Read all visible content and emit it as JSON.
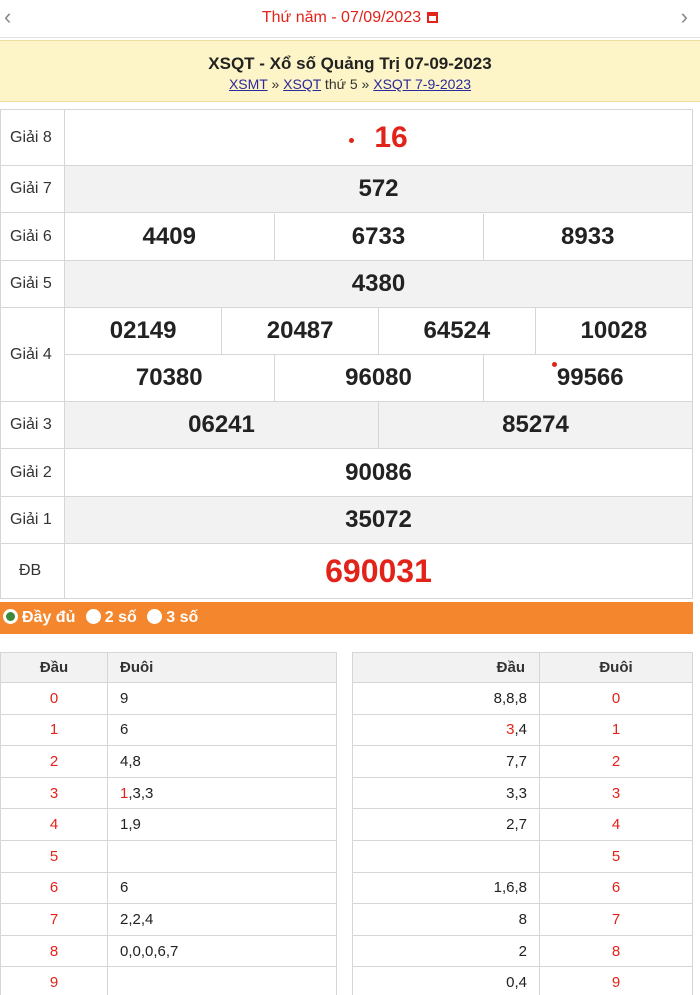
{
  "datebar": {
    "prev_icon": "chevron-left-icon",
    "next_icon": "chevron-right-icon",
    "date_label": "Thứ năm -  07/09/2023",
    "calendar_icon": "calendar-icon"
  },
  "title": {
    "heading": "XSQT - Xổ số Quảng Trị 07-09-2023",
    "crumb1": "XSMT",
    "sep1": " » ",
    "crumb2": "XSQT",
    "crumb2_suffix": " thứ 5",
    "sep2": " » ",
    "crumb3": "XSQT 7-9-2023"
  },
  "prizes": [
    {
      "label": "Giải 8",
      "values": [
        "16"
      ]
    },
    {
      "label": "Giải 7",
      "values": [
        "572"
      ]
    },
    {
      "label": "Giải 6",
      "values": [
        "4409",
        "6733",
        "8933"
      ]
    },
    {
      "label": "Giải 5",
      "values": [
        "4380"
      ]
    },
    {
      "label": "Giải 4",
      "row1": [
        "02149",
        "20487",
        "64524",
        "10028"
      ],
      "row2": [
        "70380",
        "96080",
        "99566"
      ]
    },
    {
      "label": "Giải 3",
      "values": [
        "06241",
        "85274"
      ]
    },
    {
      "label": "Giải 2",
      "values": [
        "90086"
      ]
    },
    {
      "label": "Giải 1",
      "values": [
        "35072"
      ]
    },
    {
      "label": "ĐB",
      "values": [
        "690031"
      ]
    }
  ],
  "options": {
    "full": "Đầy đủ",
    "two": "2 số",
    "three": "3 số"
  },
  "dau_duoi_left": {
    "headers": [
      "Đầu",
      "Đuôi"
    ],
    "rows": [
      [
        "0",
        "",
        "9"
      ],
      [
        "1",
        "",
        "6"
      ],
      [
        "2",
        "",
        "4,8"
      ],
      [
        "3",
        "1",
        ",3,3"
      ],
      [
        "4",
        "",
        "1,9"
      ],
      [
        "5",
        "",
        ""
      ],
      [
        "6",
        "",
        "6"
      ],
      [
        "7",
        "",
        "2,2,4"
      ],
      [
        "8",
        "",
        "0,0,0,6,7"
      ],
      [
        "9",
        "",
        ""
      ]
    ]
  },
  "dau_duoi_right": {
    "headers": [
      "Đầu",
      "Đuôi"
    ],
    "rows": [
      [
        "",
        "8,8,8",
        "0"
      ],
      [
        "3",
        ",4",
        "1"
      ],
      [
        "",
        "7,7",
        "2"
      ],
      [
        "",
        "3,3",
        "3"
      ],
      [
        "",
        "2,7",
        "4"
      ],
      [
        "",
        "",
        "5"
      ],
      [
        "",
        "1,6,8",
        "6"
      ],
      [
        "",
        "8",
        "7"
      ],
      [
        "",
        "2",
        "8"
      ],
      [
        "",
        "0,4",
        "9"
      ]
    ]
  }
}
